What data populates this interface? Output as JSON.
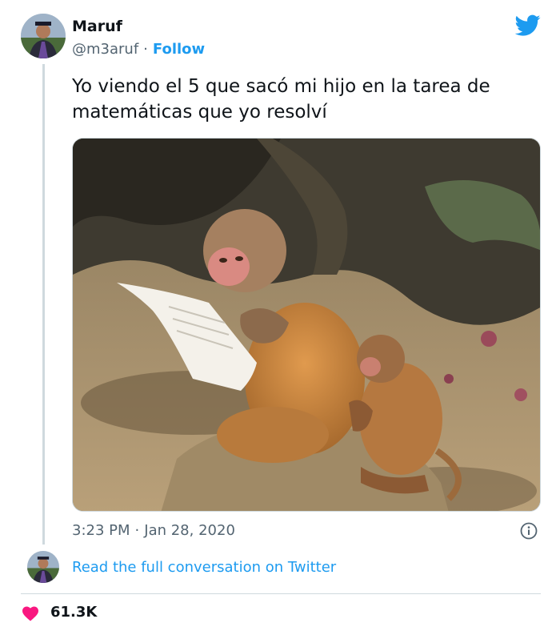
{
  "tweet": {
    "author_name": "Maruf",
    "handle": "@m3aruf",
    "separator": "·",
    "follow_label": "Follow",
    "text": "Yo viendo el 5 que sacó mi hijo en la tarea de matemáticas que yo resolví",
    "time": "3:23 PM",
    "date": "Jan 28, 2020",
    "read_conversation_label": "Read the full conversation on Twitter",
    "likes": "61.3K"
  },
  "icons": {
    "brand": "twitter-bird-icon",
    "info": "info-icon",
    "like": "heart-icon"
  },
  "colors": {
    "accent": "#1d9bf0",
    "heart": "#f91880",
    "text": "#0f1419",
    "muted": "#536471"
  }
}
